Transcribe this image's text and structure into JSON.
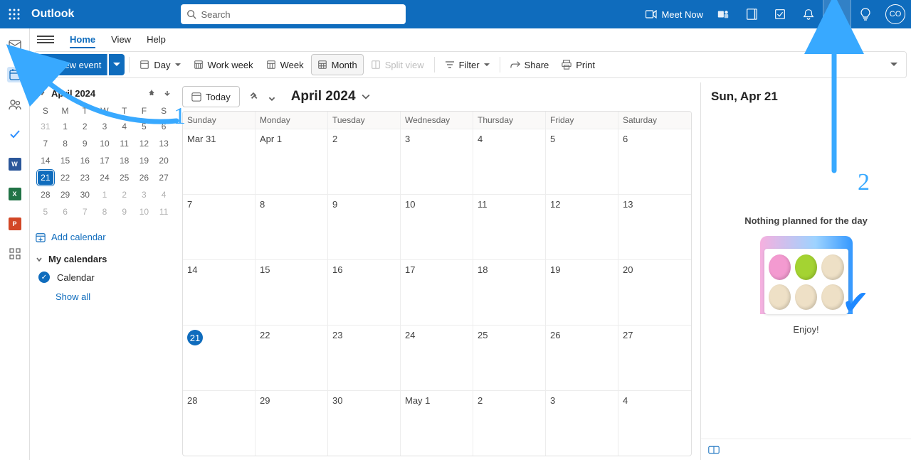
{
  "header": {
    "app_title": "Outlook",
    "search_placeholder": "Search",
    "meet_now": "Meet Now",
    "avatar_initials": "CO"
  },
  "tabs": {
    "home": "Home",
    "view": "View",
    "help": "Help"
  },
  "toolbar": {
    "new_event": "New event",
    "day": "Day",
    "work_week": "Work week",
    "week": "Week",
    "month": "Month",
    "split_view": "Split view",
    "filter": "Filter",
    "share": "Share",
    "print": "Print"
  },
  "mini_cal": {
    "title": "April 2024",
    "dow": [
      "S",
      "M",
      "T",
      "W",
      "T",
      "F",
      "S"
    ],
    "weeks": [
      [
        {
          "d": "31",
          "o": true
        },
        {
          "d": "1"
        },
        {
          "d": "2"
        },
        {
          "d": "3"
        },
        {
          "d": "4"
        },
        {
          "d": "5"
        },
        {
          "d": "6"
        }
      ],
      [
        {
          "d": "7"
        },
        {
          "d": "8"
        },
        {
          "d": "9"
        },
        {
          "d": "10"
        },
        {
          "d": "11"
        },
        {
          "d": "12"
        },
        {
          "d": "13"
        }
      ],
      [
        {
          "d": "14"
        },
        {
          "d": "15"
        },
        {
          "d": "16"
        },
        {
          "d": "17"
        },
        {
          "d": "18"
        },
        {
          "d": "19"
        },
        {
          "d": "20"
        }
      ],
      [
        {
          "d": "21",
          "today": true
        },
        {
          "d": "22"
        },
        {
          "d": "23"
        },
        {
          "d": "24"
        },
        {
          "d": "25"
        },
        {
          "d": "26"
        },
        {
          "d": "27"
        }
      ],
      [
        {
          "d": "28"
        },
        {
          "d": "29"
        },
        {
          "d": "30"
        },
        {
          "d": "1",
          "o": true
        },
        {
          "d": "2",
          "o": true
        },
        {
          "d": "3",
          "o": true
        },
        {
          "d": "4",
          "o": true
        }
      ],
      [
        {
          "d": "5",
          "o": true
        },
        {
          "d": "6",
          "o": true
        },
        {
          "d": "7",
          "o": true
        },
        {
          "d": "8",
          "o": true
        },
        {
          "d": "9",
          "o": true
        },
        {
          "d": "10",
          "o": true
        },
        {
          "d": "11",
          "o": true
        }
      ]
    ],
    "add_calendar": "Add calendar",
    "my_calendars": "My calendars",
    "calendar_item": "Calendar",
    "show_all": "Show all"
  },
  "cal": {
    "today": "Today",
    "title": "April 2024",
    "dow": [
      "Sunday",
      "Monday",
      "Tuesday",
      "Wednesday",
      "Thursday",
      "Friday",
      "Saturday"
    ],
    "cells": [
      "Mar 31",
      "Apr 1",
      "2",
      "3",
      "4",
      "5",
      "6",
      "7",
      "8",
      "9",
      "10",
      "11",
      "12",
      "13",
      "14",
      "15",
      "16",
      "17",
      "18",
      "19",
      "20",
      "21",
      "22",
      "23",
      "24",
      "25",
      "26",
      "27",
      "28",
      "29",
      "30",
      "May 1",
      "2",
      "3",
      "4"
    ],
    "today_index": 21
  },
  "right": {
    "title": "Sun, Apr 21",
    "nothing": "Nothing planned for the day",
    "enjoy": "Enjoy!"
  },
  "annotations": {
    "label1": "1",
    "label2": "2"
  }
}
